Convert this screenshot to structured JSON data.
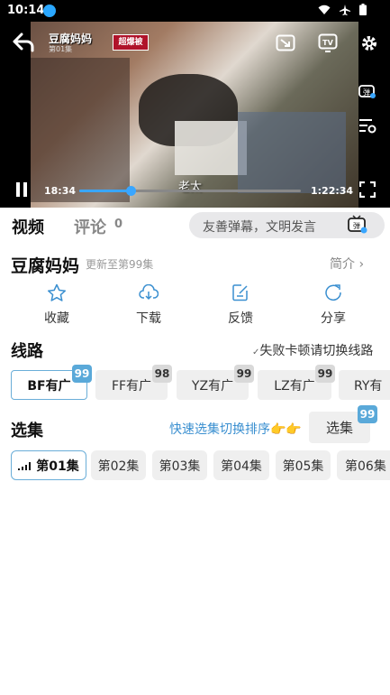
{
  "status": {
    "time": "10:14"
  },
  "video": {
    "title": "豆腐妈妈",
    "subtitle_line": "第01集",
    "logo": "超爆被",
    "caption": "老太",
    "current_time": "18:34",
    "total_time": "1:22:34",
    "progress": 0.23
  },
  "tabs": {
    "video": "视频",
    "comment": "评论",
    "comment_count": "0"
  },
  "danmaku": {
    "placeholder": "友善弹幕，文明发言",
    "icon_label": "弹"
  },
  "show": {
    "title": "豆腐妈妈",
    "update": "更新至第99集",
    "intro": "简介 ›"
  },
  "actions": [
    {
      "label": "收藏",
      "icon": "star-icon"
    },
    {
      "label": "下载",
      "icon": "download-icon"
    },
    {
      "label": "反馈",
      "icon": "feedback-icon"
    },
    {
      "label": "分享",
      "icon": "share-icon"
    }
  ],
  "lines": {
    "title": "线路",
    "hint": "失败卡顿请切换线路",
    "items": [
      {
        "label": "BF有广",
        "badge": "99"
      },
      {
        "label": "FF有广",
        "badge": "98"
      },
      {
        "label": "YZ有广",
        "badge": "99"
      },
      {
        "label": "LZ有广",
        "badge": "99"
      },
      {
        "label": "RY有"
      }
    ]
  },
  "episodes": {
    "title": "选集",
    "fast_sort": "快速选集切换排序👉👉",
    "select_button": "选集",
    "select_badge": "99",
    "items": [
      "第01集",
      "第02集",
      "第03集",
      "第04集",
      "第05集",
      "第06集"
    ]
  }
}
